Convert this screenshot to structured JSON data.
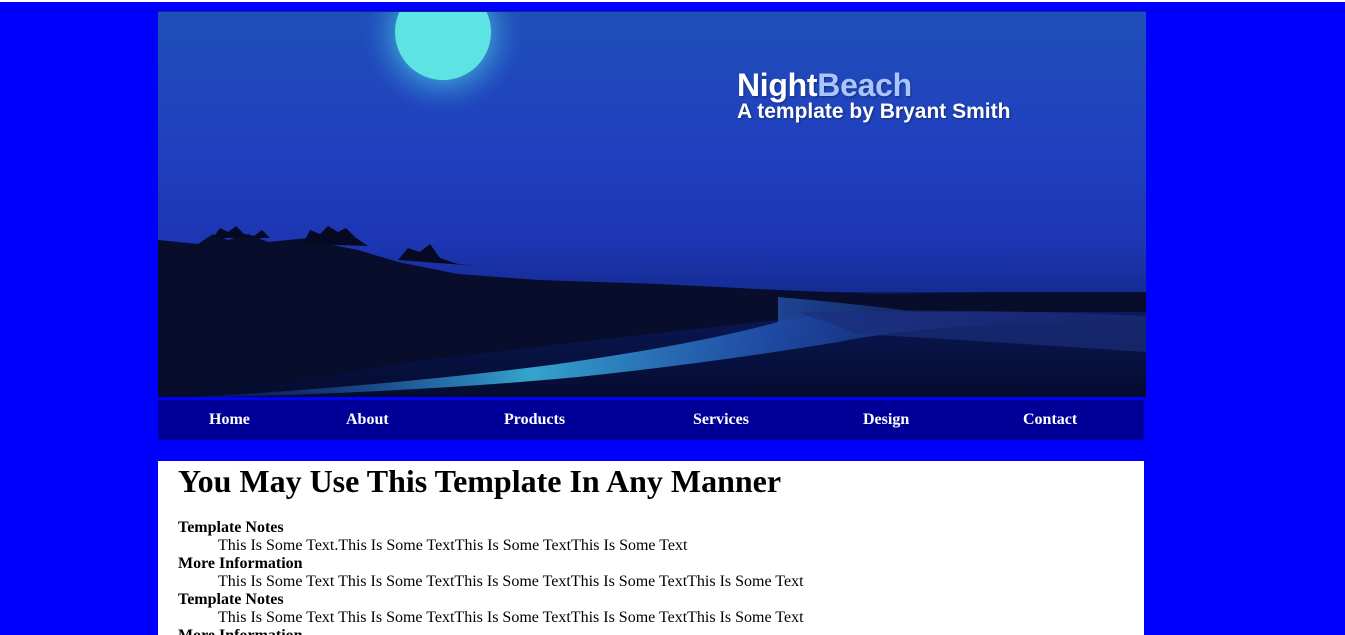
{
  "banner": {
    "brand_main": "Night",
    "brand_accent": "Beach",
    "tagline": "A template by Bryant Smith"
  },
  "nav": {
    "items": [
      {
        "label": "Home"
      },
      {
        "label": "About"
      },
      {
        "label": "Products"
      },
      {
        "label": "Services"
      },
      {
        "label": "Design"
      },
      {
        "label": "Contact"
      }
    ]
  },
  "content": {
    "heading": "You May Use This Template In Any Manner",
    "entries": [
      {
        "term": "Template Notes",
        "text": "This Is Some Text.This Is Some TextThis Is Some TextThis Is Some Text"
      },
      {
        "term": "More Information",
        "text": "This Is Some Text This Is Some TextThis Is Some TextThis Is Some TextThis Is Some Text"
      },
      {
        "term": "Template Notes",
        "text": "This Is Some Text This Is Some TextThis Is Some TextThis Is Some TextThis Is Some Text"
      },
      {
        "term": "More Information",
        "text": ""
      }
    ]
  },
  "colors": {
    "page_background": "#0000ff",
    "nav_background": "#000099",
    "content_background": "#ffffff",
    "brand_accent": "#a9c4ff"
  }
}
